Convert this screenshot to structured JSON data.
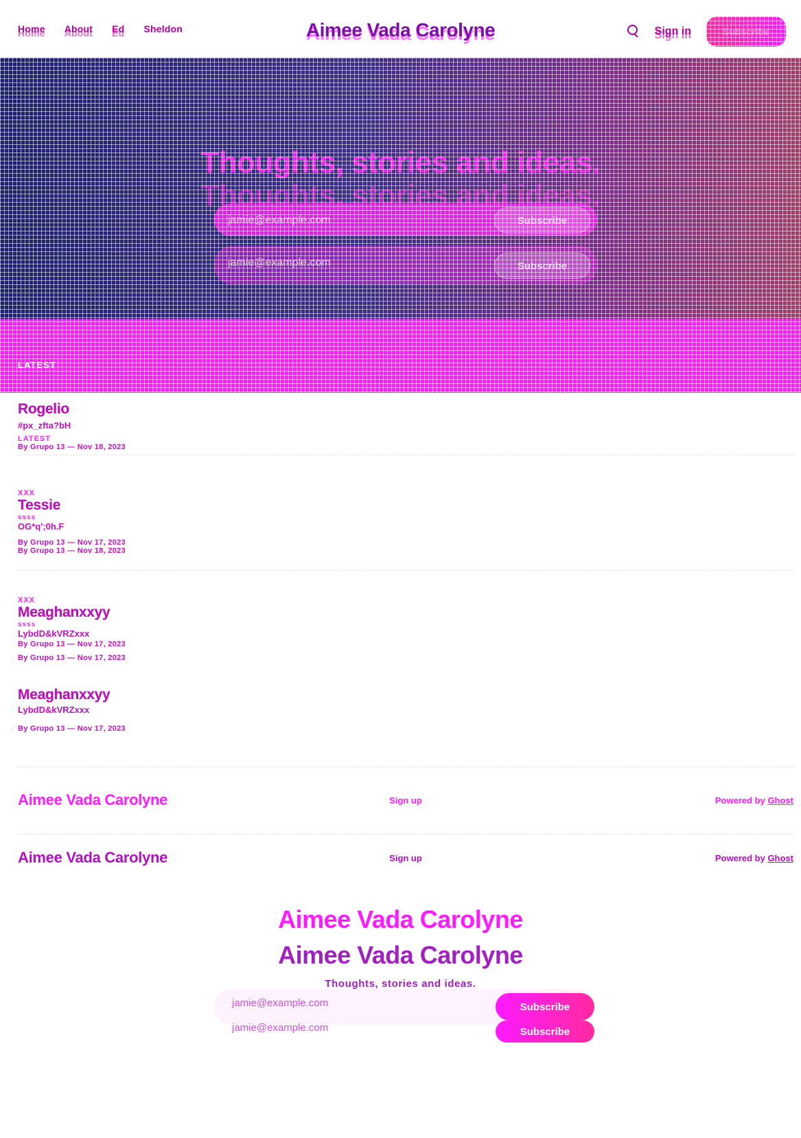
{
  "site": {
    "name": "Aimee Vada Carolyne"
  },
  "nav": {
    "items": [
      "Home",
      "About",
      "Ed",
      "Sheldon"
    ]
  },
  "header": {
    "signin_label": "Sign in",
    "subscribe_label": "Subscribe"
  },
  "hero": {
    "title": "Thoughts, stories and ideas.",
    "email_placeholder": "jamie@example.com",
    "subscribe_label": "Subscribe",
    "latest_label": "LATEST"
  },
  "posts": [
    {
      "title": "Rogelio",
      "excerpt": "#px_zfta?bH",
      "tag": "LATEST",
      "meta": "By Grupo 13 — Nov 18, 2023"
    },
    {
      "tag": "XXX",
      "title": "Tessie",
      "subtag": "ssss",
      "excerpt": "OG*q';0h.F",
      "meta": "By Grupo 13 — Nov 18, 2023",
      "meta_alt": "By Grupo 13 — Nov 17, 2023"
    },
    {
      "tag": "XXX",
      "title": "Meaghanxxyy",
      "subtag": "ssss",
      "excerpt": "LybdD&kVRZxxx",
      "meta": "By Grupo 13 — Nov 17, 2023"
    },
    {
      "title": "Meaghanxxyy",
      "excerpt": "LybdD&kVRZxxx",
      "meta": "By Grupo 13 — Nov 17, 2023"
    }
  ],
  "footer": {
    "brand": "Aimee Vada Carolyne",
    "signup_label": "Sign up",
    "powered_prefix": "Powered by ",
    "powered_link": "Ghost"
  },
  "signup": {
    "title": "Aimee Vada Carolyne",
    "description": "Thoughts, stories and ideas.",
    "email_placeholder": "jamie@example.com",
    "button_label": "Subscribe"
  },
  "colors": {
    "accent": "#ff1aff",
    "hero_left": "#1e2070",
    "hero_right": "#a33a6a"
  }
}
